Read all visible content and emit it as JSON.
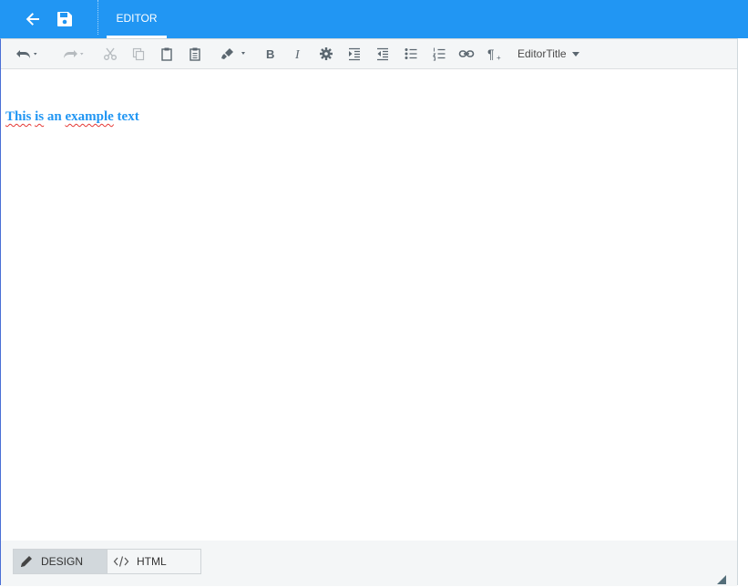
{
  "appbar": {
    "tab_label": "EDITOR",
    "back_icon": "arrow-left-icon",
    "save_icon": "floppy-disk-icon",
    "color": "#2196f3"
  },
  "toolbar": {
    "style_select_label": "EditorTitle",
    "buttons": [
      "undo",
      "redo",
      "cut",
      "copy",
      "paste",
      "paste-special",
      "format-painter",
      "bold",
      "italic",
      "settings",
      "indent",
      "outdent",
      "bulleted-list",
      "numbered-list",
      "link",
      "paragraph"
    ]
  },
  "content": {
    "words": [
      "This",
      "is",
      "an",
      "example",
      "text"
    ]
  },
  "bottom": {
    "design_label": "DESIGN",
    "html_label": "HTML"
  }
}
